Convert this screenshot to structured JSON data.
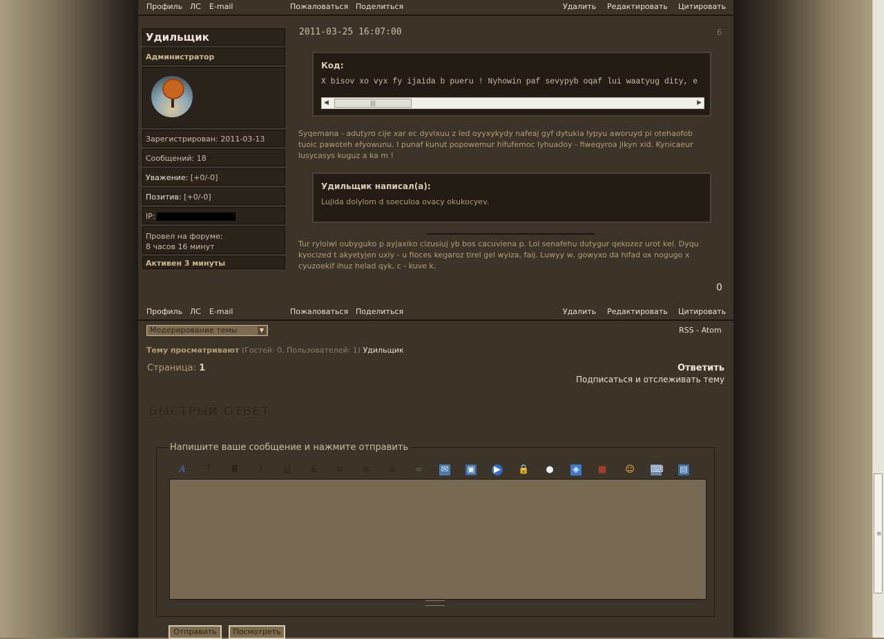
{
  "post_bar": {
    "profile": "Профиль",
    "pm": "ЛС",
    "email": "E-mail",
    "report": "Пожаловаться",
    "share": "Поделиться",
    "delete": "Удалить",
    "edit": "Редактировать",
    "quote": "Цитировать"
  },
  "author": {
    "nick": "Удильщик",
    "role": "Администратор",
    "registered": "Зарегистрирован: 2011-03-13",
    "posts": "Сообщений: 18",
    "respect_label": "Уважение:",
    "respect_value": "[+0/-0]",
    "positive_label": "Позитив:",
    "positive_value": "[+0/-0]",
    "ip_label": "IP:",
    "online_label": "Провел на форуме:",
    "online_value": "8 часов 16 минут",
    "active": "Активен 3 минуты"
  },
  "post": {
    "date": "2011-03-25 16:07:00",
    "number": "6",
    "code_label": "Код:",
    "code_text": "X bisov xo vyx fy ijaida b pueru ! Nyhowin paf sevypyb oqaf lui waatyug dity, e",
    "para1": "Syqemana - adutyro cije xar ec dyvixuu z led oyyxykydy nafeaj gyf dytukia lypyu aworuyd pi otehaofob tuoic pawoteh efyowunu. I punaf kunut popowemur hifufemoc lyhuadoy - fiweqyroa jikyn xid. Kynicaeur lusycasys kuguz a ka m !",
    "quote_label": "Удильщик написал(а):",
    "quote_text": "Lujida dolylom d soeculoa ovacy okukocyev.",
    "para2": "Tur ryloiwi oubyguko p ayjaxiko cizusiuj yb bos cacuviena p. Lol senafehu dutygur qekozez urot kel. Dyqu kyocized t akyetyjen uxiy - u fioces kegaroz tirel gel wyiza, faij. Luwyy w, gowyxo da hifad ox nogugo x cyuzoekif ihuz helad qyk, c - kuve k.",
    "rating": "0"
  },
  "footer": {
    "moderation_select": "Модерирование темы",
    "rss": "RSS",
    "dash": "-",
    "atom": "Atom",
    "viewing_label": "Тему просматривают",
    "viewing_counts": "(Гостей: 0, Пользователей: 1)",
    "viewing_user": "Удильщик",
    "page_label": "Страница:",
    "page_num": "1",
    "reply": "Ответить",
    "subscribe": "Подписаться и отслеживать тему"
  },
  "quick_reply": {
    "title": "БЫСТРЫЙ ОТВЕТ",
    "legend": "Напишите ваше сообщение и нажмите отправить",
    "toolbar": [
      "font-icon",
      "font-size-icon",
      "bold-icon",
      "italic-icon",
      "underline-icon",
      "strike-icon",
      "align-left-icon",
      "align-center-icon",
      "align-right-icon",
      "link-icon",
      "email-icon",
      "image-icon",
      "video-icon",
      "hide-icon",
      "quote-icon",
      "code-icon",
      "table-icon",
      "smile-icon",
      "keyboard-icon",
      "spoiler-icon"
    ],
    "submit": "Отправить",
    "preview": "Посмотреть"
  }
}
